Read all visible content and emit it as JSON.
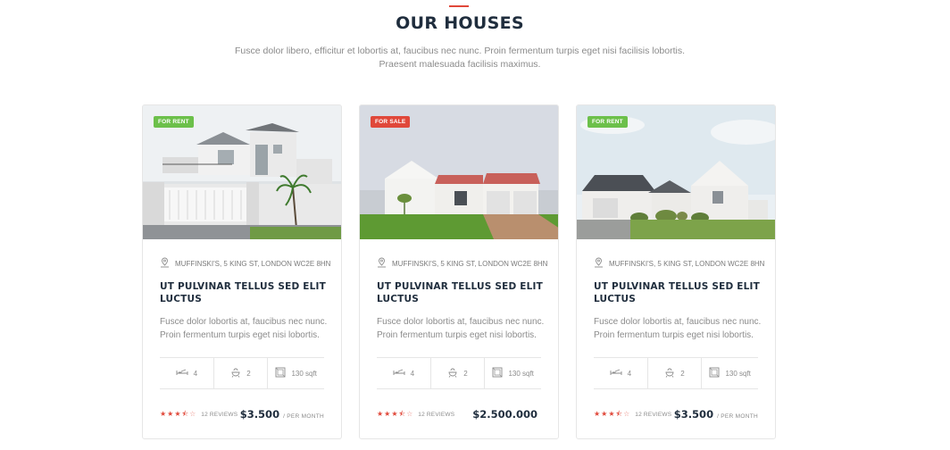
{
  "section": {
    "title": "OUR HOUSES",
    "subtitle_line1": "Fusce dolor libero, efficitur et lobortis at, faucibus nec nunc. Proin fermentum turpis eget nisi facilisis lobortis.",
    "subtitle_line2": "Praesent malesuada facilisis maximus."
  },
  "colors": {
    "accent": "#e0483a",
    "rent_badge": "#6cc04a",
    "sale_badge": "#e0483a",
    "heading": "#1f2d3d"
  },
  "cards": [
    {
      "badge": "FOR RENT",
      "address": "MUFFINSKI'S, 5 KING ST, LONDON WC2E 8HN",
      "title": "UT PULVINAR TELLUS SED ELIT LUCTUS",
      "desc": "Fusce dolor lobortis at, faucibus nec nunc. Proin fermentum turpis eget nisi lobortis.",
      "beds": "4",
      "baths": "2",
      "area": "130 sqft",
      "rating": 3.5,
      "reviews": "12 REVIEWS",
      "price": "$3.500",
      "per": "/ PER MONTH"
    },
    {
      "badge": "FOR SALE",
      "address": "MUFFINSKI'S, 5 KING ST, LONDON WC2E 8HN",
      "title": "UT PULVINAR TELLUS SED ELIT LUCTUS",
      "desc": "Fusce dolor lobortis at, faucibus nec nunc. Proin fermentum turpis eget nisi lobortis.",
      "beds": "4",
      "baths": "2",
      "area": "130 sqft",
      "rating": 3.5,
      "reviews": "12 REVIEWS",
      "price": "$2.500.000",
      "per": ""
    },
    {
      "badge": "FOR RENT",
      "address": "MUFFINSKI'S, 5 KING ST, LONDON WC2E 8HN",
      "title": "UT PULVINAR TELLUS SED ELIT LUCTUS",
      "desc": "Fusce dolor lobortis at, faucibus nec nunc. Proin fermentum turpis eget nisi lobortis.",
      "beds": "4",
      "baths": "2",
      "area": "130 sqft",
      "rating": 3.5,
      "reviews": "12 REVIEWS",
      "price": "$3.500",
      "per": "/ PER MONTH"
    }
  ],
  "icons": {
    "address": "map-pin-icon",
    "beds": "bed-icon",
    "baths": "shower-icon",
    "area": "area-icon",
    "rating": "star-icon"
  }
}
